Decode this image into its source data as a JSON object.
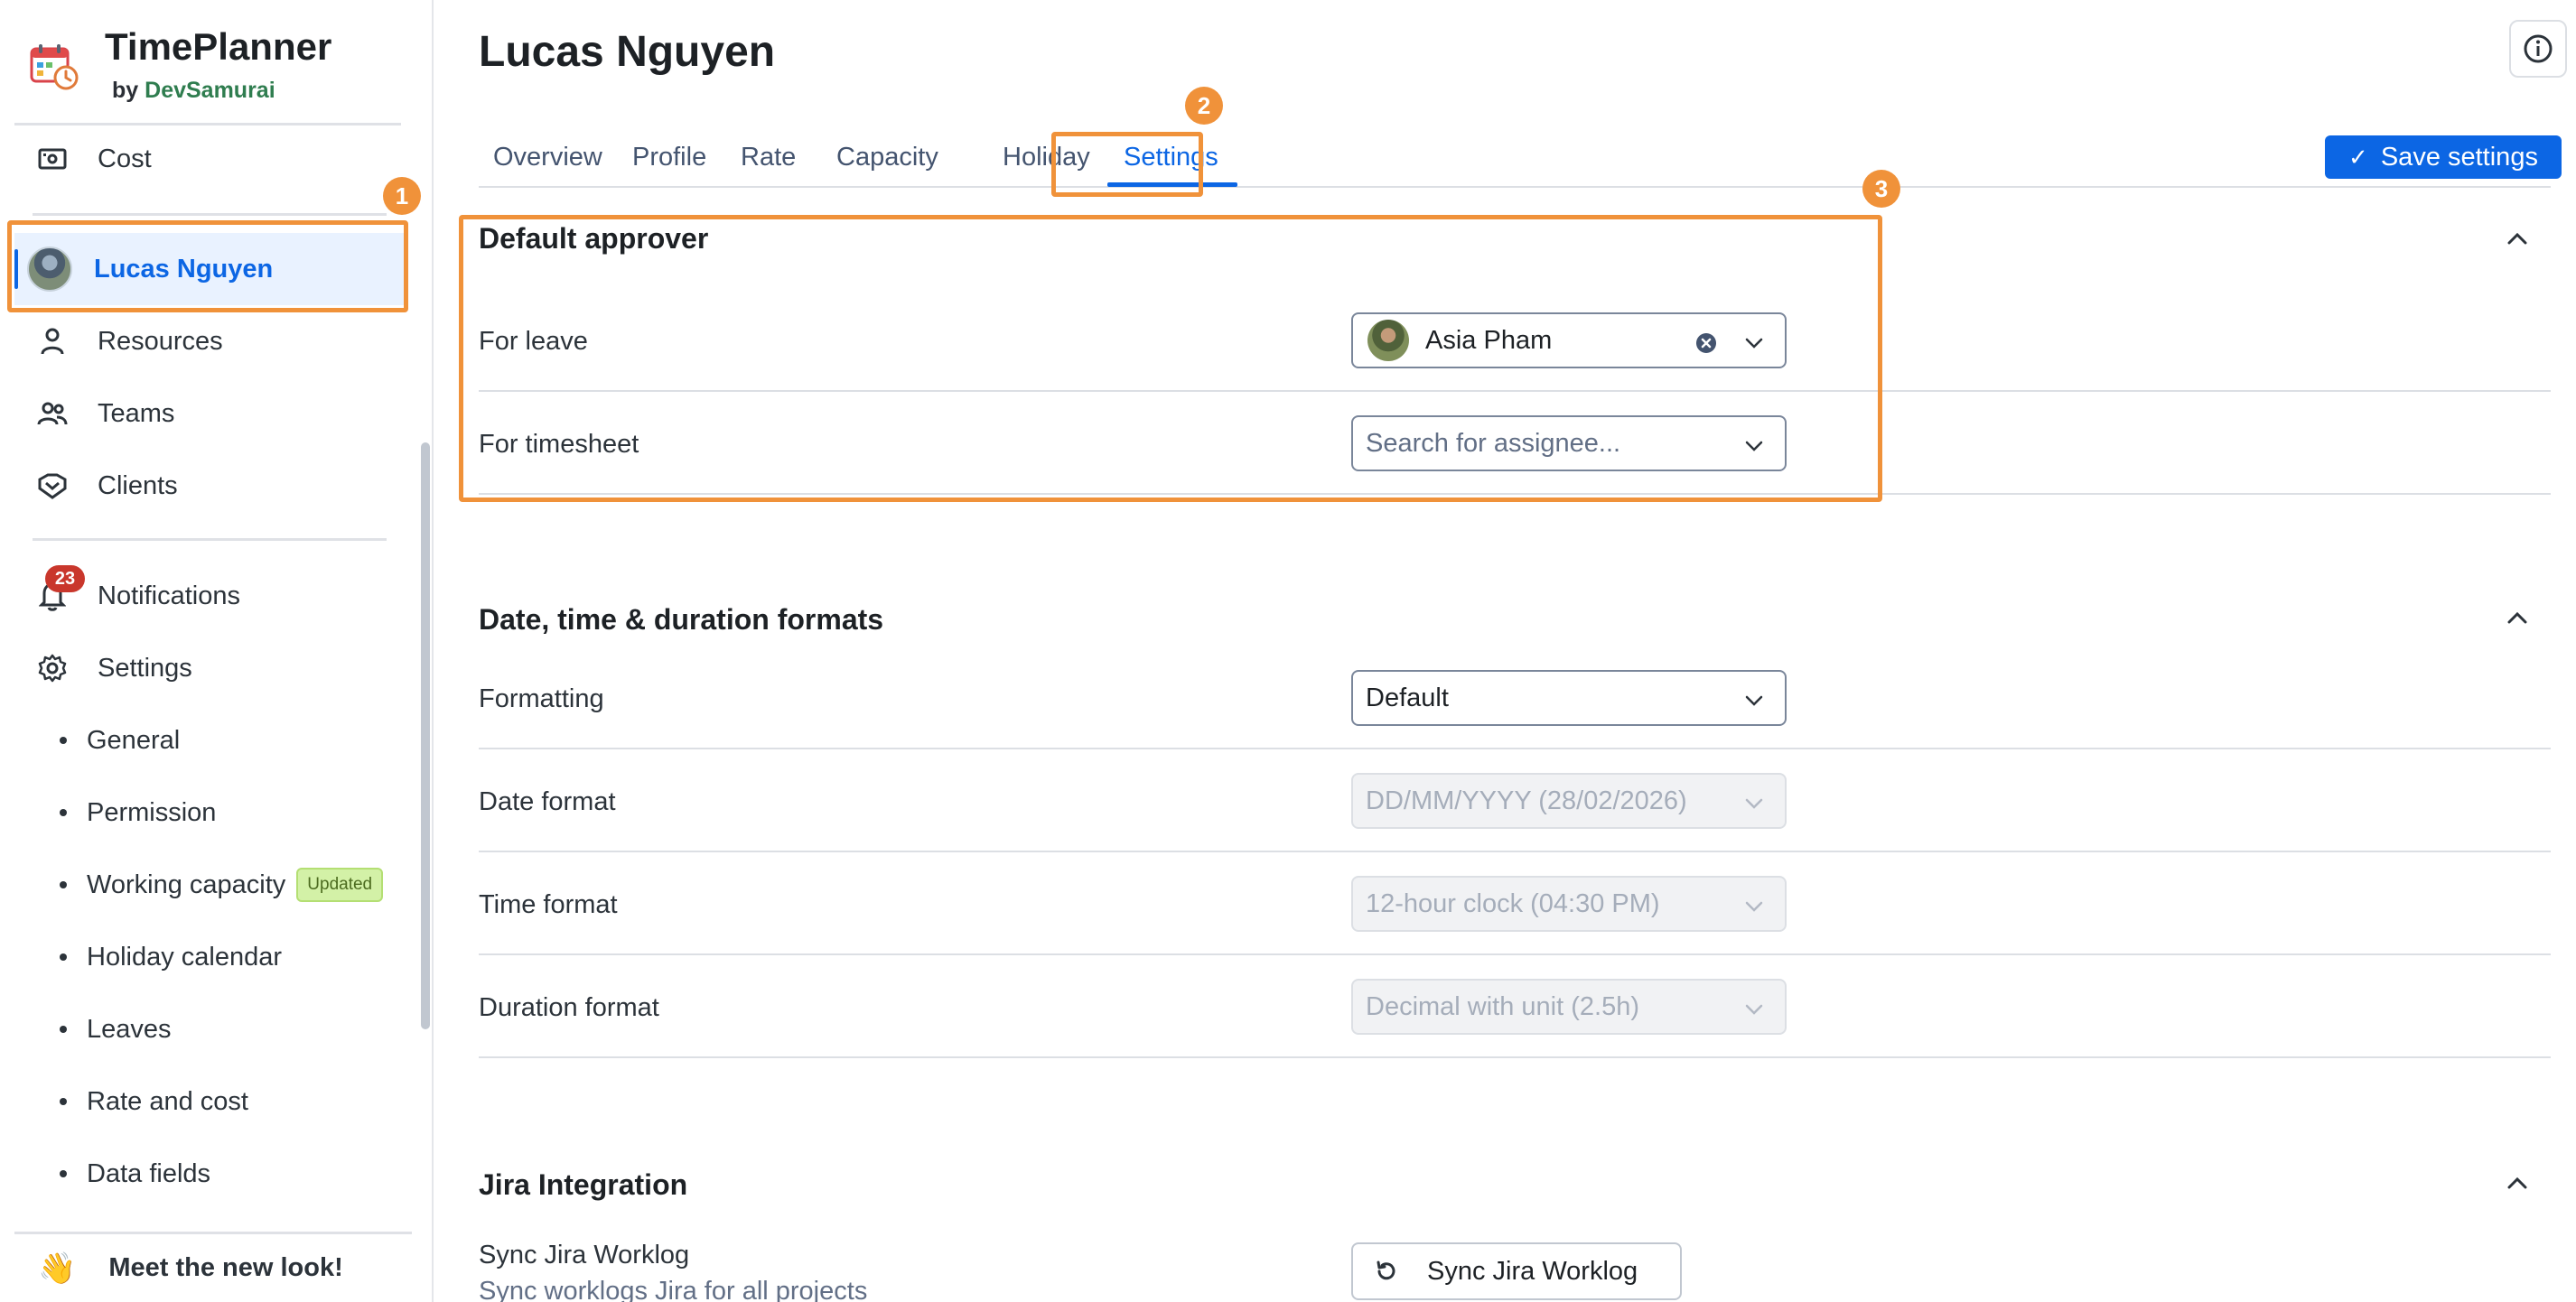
{
  "app": {
    "title": "TimePlanner",
    "by_prefix": "by",
    "by_brand": "DevSamurai"
  },
  "sidebar": {
    "cost": "Cost",
    "current_user": "Lucas Nguyen",
    "resources": "Resources",
    "teams": "Teams",
    "clients": "Clients",
    "notifications": "Notifications",
    "notifications_count": "23",
    "settings": "Settings",
    "sub_items": {
      "general": "General",
      "permission": "Permission",
      "working_capacity": "Working capacity",
      "working_capacity_badge": "Updated",
      "holiday_calendar": "Holiday calendar",
      "leaves": "Leaves",
      "rate_and_cost": "Rate and cost",
      "data_fields": "Data fields"
    },
    "footer": {
      "emoji": "👋",
      "label": "Meet the new look!"
    }
  },
  "header": {
    "title": "Lucas Nguyen",
    "save_label": "Save settings"
  },
  "tabs": {
    "overview": "Overview",
    "profile": "Profile",
    "rate": "Rate",
    "capacity": "Capacity",
    "holiday": "Holiday",
    "settings": "Settings"
  },
  "sections": {
    "approver": {
      "title": "Default approver",
      "leave_label": "For leave",
      "leave_value": "Asia Pham",
      "timesheet_label": "For timesheet",
      "timesheet_placeholder": "Search for assignee..."
    },
    "formats": {
      "title": "Date, time & duration formats",
      "formatting_label": "Formatting",
      "formatting_value": "Default",
      "date_label": "Date format",
      "date_value": "DD/MM/YYYY (28/02/2026)",
      "time_label": "Time format",
      "time_value": "12-hour clock (04:30 PM)",
      "duration_label": "Duration format",
      "duration_value": "Decimal with unit (2.5h)"
    },
    "jira": {
      "title": "Jira Integration",
      "sync_label": "Sync Jira Worklog",
      "sync_desc": "Sync worklogs Jira for all projects",
      "sync_button": "Sync Jira Worklog"
    }
  },
  "annotations": {
    "one": "1",
    "two": "2",
    "three": "3"
  },
  "colors": {
    "accent": "#0c66e4",
    "highlight": "#f0923a",
    "badge_red": "#c9372c"
  }
}
